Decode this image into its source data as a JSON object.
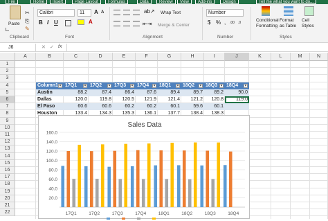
{
  "ribbon_tabs": [
    "File",
    "Home",
    "Insert",
    "Page Layout",
    "Formulas",
    "Data",
    "Review",
    "View",
    "Add-ins",
    "Design",
    "Tell me what you want to do..."
  ],
  "ribbon": {
    "paste_label": "Paste",
    "font_name": "Calibri",
    "font_size": "11",
    "wrap_text": "Wrap Text",
    "merge_center": "Merge & Center",
    "number_format": "Number",
    "conditional_formatting": "Conditional Formatting",
    "format_as_table": "Format as Table",
    "cell_styles": "Cell Styles",
    "groups": {
      "clipboard": "Clipboard",
      "font": "Font",
      "alignment": "Alignment",
      "number": "Number",
      "styles": "Styles"
    }
  },
  "formula_bar": {
    "name_box": "J6",
    "fx": "fx"
  },
  "columns": [
    "A",
    "B",
    "C",
    "D",
    "E",
    "F",
    "G",
    "H",
    "I",
    "J",
    "K",
    "L",
    "M",
    "N"
  ],
  "rows": [
    "1",
    "2",
    "3",
    "4",
    "5",
    "6",
    "7",
    "8",
    "9",
    "10",
    "11",
    "12",
    "13",
    "14",
    "15",
    "16",
    "17",
    "18",
    "19",
    "20",
    "21",
    "22"
  ],
  "table": {
    "headers": [
      "Column1",
      "17Q1",
      "17Q2",
      "17Q3",
      "17Q4",
      "18Q1",
      "18Q2",
      "18Q3",
      "18Q4"
    ],
    "rows": [
      [
        "Austin",
        "88.2",
        "87.4",
        "86.4",
        "87.6",
        "89.4",
        "89.7",
        "89.2",
        "90.0"
      ],
      [
        "Dallas",
        "120.0",
        "119.8",
        "120.5",
        "121.9",
        "121.4",
        "121.2",
        "120.8",
        "119.0"
      ],
      [
        "El Paso",
        "60.6",
        "60.6",
        "60.2",
        "60.2",
        "60.1",
        "59.6",
        "60.1",
        ""
      ],
      [
        "Houston",
        "133.4",
        "134.3",
        "135.3",
        "136.1",
        "137.7",
        "138.4",
        "138.3",
        ""
      ]
    ]
  },
  "chart_data": {
    "type": "bar",
    "title": "Sales Data",
    "categories": [
      "17Q1",
      "17Q2",
      "17Q3",
      "17Q4",
      "18Q1",
      "18Q2",
      "18Q3",
      "18Q4"
    ],
    "series": [
      {
        "name": "Austin",
        "color": "#5b9bd5",
        "values": [
          88.2,
          87.4,
          86.4,
          87.6,
          89.4,
          89.7,
          89.2,
          90.0
        ]
      },
      {
        "name": "Dallas",
        "color": "#ed7d31",
        "values": [
          120.0,
          119.8,
          120.5,
          121.9,
          121.4,
          121.2,
          120.8,
          119.0
        ]
      },
      {
        "name": "El Paso",
        "color": "#a5a5a5",
        "values": [
          60.6,
          60.6,
          60.2,
          60.2,
          60.1,
          59.6,
          60.1,
          0
        ]
      },
      {
        "name": "Houston",
        "color": "#ffc000",
        "values": [
          133.4,
          134.3,
          135.3,
          136.1,
          137.7,
          138.4,
          138.3,
          0
        ]
      }
    ],
    "yticks": [
      "160.0",
      "140.0",
      "120.0",
      "100.0",
      "80.0",
      "60.0",
      "40.0",
      "20.0"
    ],
    "ylim": [
      0,
      160
    ],
    "grid": true
  }
}
